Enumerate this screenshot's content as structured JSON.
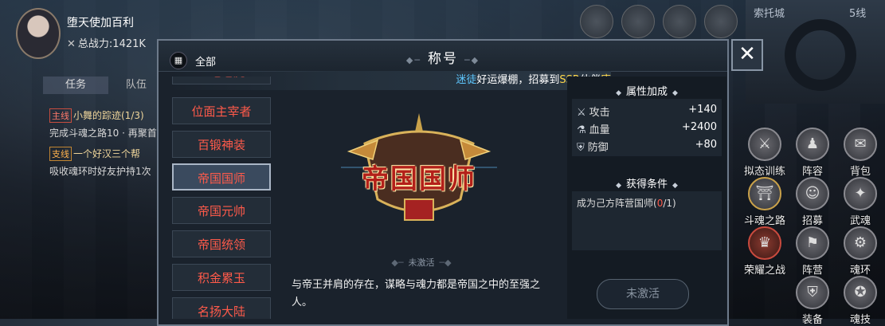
{
  "player": {
    "name": "堕天使加百利",
    "power_label": "总战力:",
    "power_value": "1421K"
  },
  "tasks": {
    "tabs": [
      "任务",
      "队伍"
    ],
    "items": [
      {
        "tag": "主线",
        "title": "小舞的踪迹(1/3)",
        "desc": "完成斗魂之路10 · 再聚首"
      },
      {
        "tag": "支线",
        "title": "一个好汉三个帮",
        "desc": "吸收魂环时好友护持1次"
      }
    ]
  },
  "minimap": {
    "location": "索托城",
    "line": "5线"
  },
  "side_buttons": [
    {
      "label": "拟态训练",
      "icon": "⚔"
    },
    {
      "label": "阵容",
      "icon": "♟"
    },
    {
      "label": "背包",
      "icon": "✉"
    },
    {
      "label": "斗魂之路",
      "icon": "⛩"
    },
    {
      "label": "招募",
      "icon": "☺"
    },
    {
      "label": "武魂",
      "icon": "✦"
    },
    {
      "label": "荣耀之战",
      "icon": "♛"
    },
    {
      "label": "阵营",
      "icon": "⚑"
    },
    {
      "label": "魂环",
      "icon": "⚙"
    },
    {
      "label": "装备",
      "icon": "⛨"
    },
    {
      "label": "魂技",
      "icon": "✪"
    }
  ],
  "modal": {
    "title": "称号",
    "filter_label": "全部",
    "close": "✕",
    "announce": {
      "part1": "迷徒",
      "part2": "好运爆棚，招募到",
      "part3": "SSR",
      "part4": "伙伴",
      "part5": "唐"
    },
    "titles": [
      "金毛老虎",
      "位面主宰者",
      "百锻神装",
      "帝国国师",
      "帝国元帅",
      "帝国统领",
      "积金累玉",
      "名扬大陆"
    ],
    "selected": {
      "badge_text": "帝国国师",
      "status": "未激活",
      "flavor": "与帝王并肩的存在，谋略与魂力都是帝国之中的至强之人。"
    },
    "attributes": {
      "title": "属性加成",
      "items": [
        {
          "icon": "sword-icon",
          "name": "攻击",
          "value": "+140"
        },
        {
          "icon": "potion-icon",
          "name": "血量",
          "value": "+2400"
        },
        {
          "icon": "shield-icon",
          "name": "防御",
          "value": "+80"
        }
      ]
    },
    "condition": {
      "title": "获得条件",
      "text": "成为己方阵营国师(",
      "progress": "0",
      "total": "/1)"
    },
    "action_button": "未激活"
  }
}
